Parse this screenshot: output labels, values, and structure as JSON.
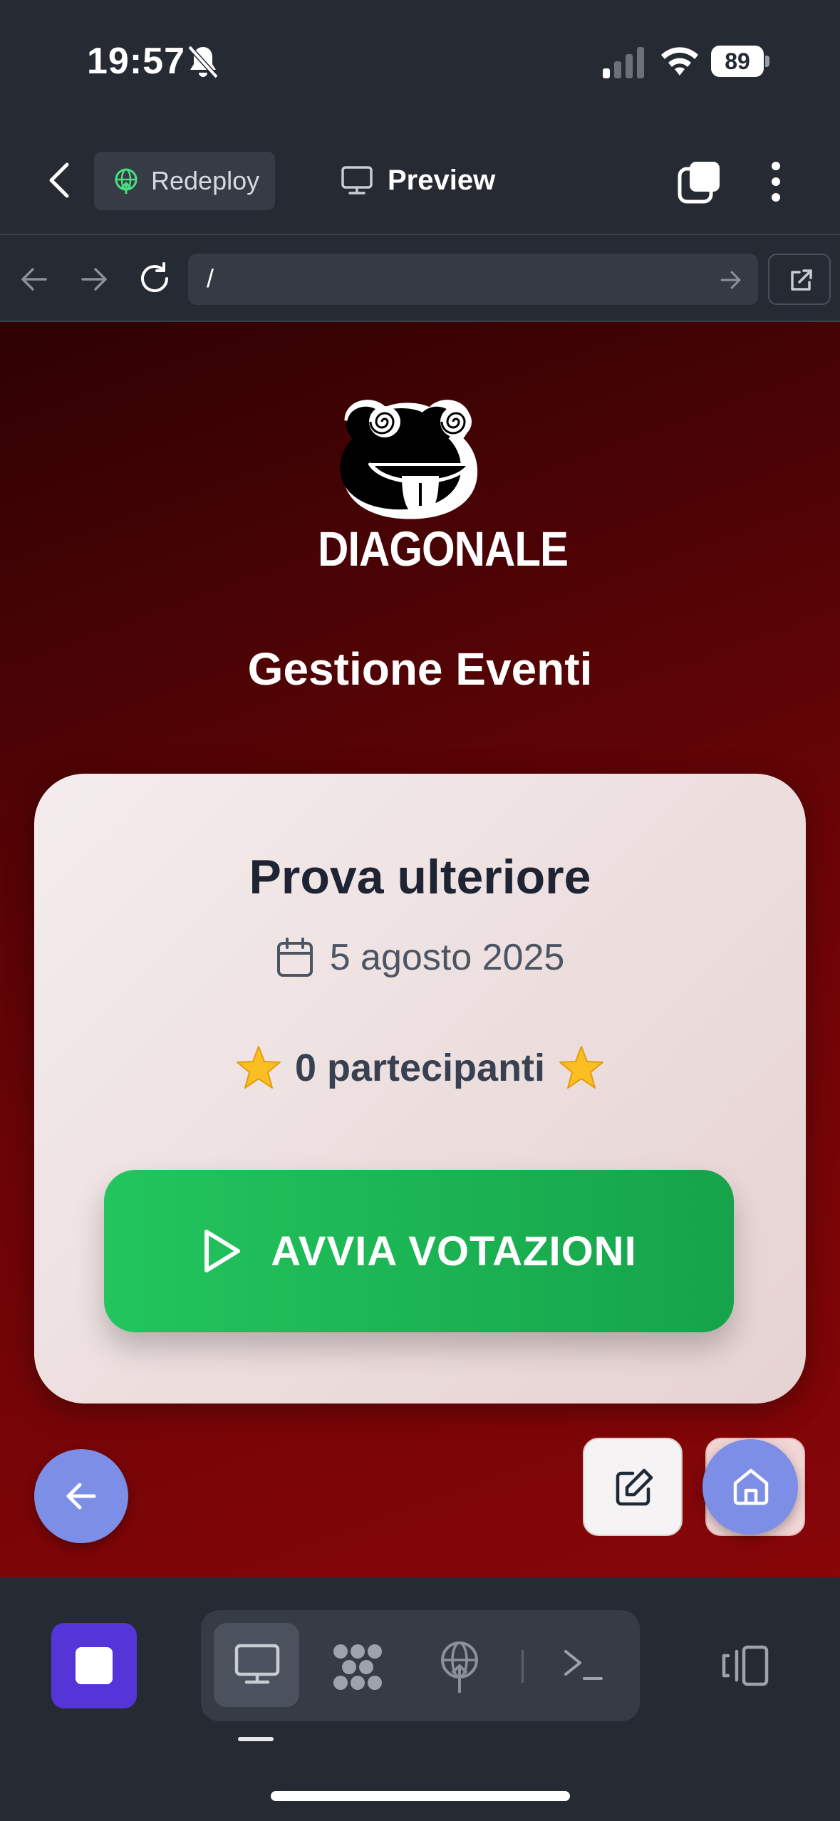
{
  "status_bar": {
    "time": "19:57",
    "battery_level": "89"
  },
  "header": {
    "redeploy_label": "Redeploy",
    "preview_label": "Preview"
  },
  "browser": {
    "url": "/"
  },
  "page": {
    "logo_text": "DIAGONALE",
    "title": "Gestione Eventi"
  },
  "event": {
    "name": "Prova ulteriore",
    "date": "5 agosto 2025",
    "participants": "0 partecipanti",
    "start_button_label": "AVVIA VOTAZIONI"
  },
  "colors": {
    "start_button": "#22c55e",
    "fab": "#7c8ee6",
    "stop_button": "#5534d8",
    "background_red": "#870608"
  },
  "icons": [
    "bell-slash-icon",
    "signal-icon",
    "wifi-icon",
    "back-chevron-icon",
    "redeploy-icon",
    "monitor-icon",
    "tabs-icon",
    "more-icon",
    "reload-icon",
    "calendar-icon",
    "star-icon",
    "play-icon",
    "arrow-left-icon",
    "edit-icon",
    "home-icon",
    "nodes-icon",
    "globe-icon",
    "terminal-icon",
    "device-icon"
  ]
}
